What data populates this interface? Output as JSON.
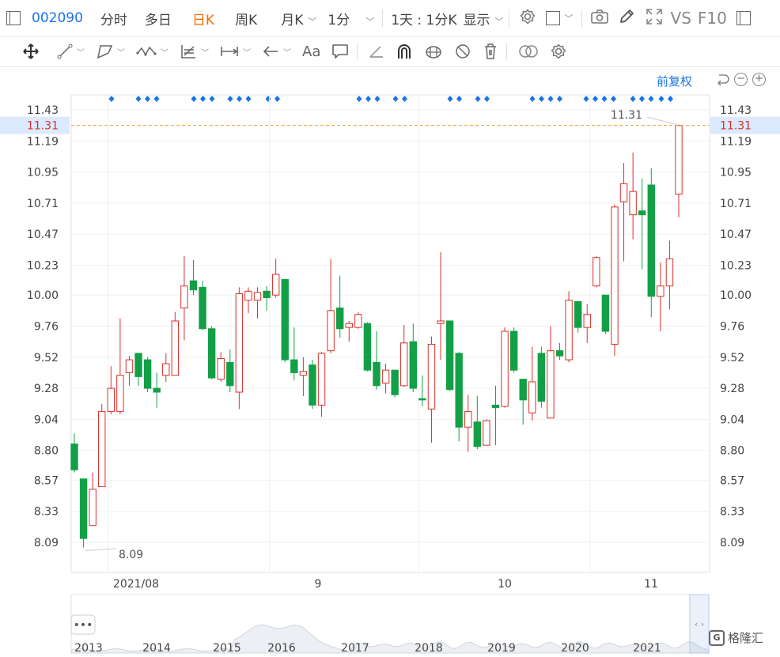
{
  "header": {
    "code": "002090",
    "tabs": [
      "分时",
      "多日",
      "日K",
      "周K",
      "月K",
      "1分"
    ],
    "active_tab": "日K",
    "range_label": "1天 : 1分K",
    "display_label": "显示",
    "vs_label": "VS",
    "f10_label": "F10"
  },
  "toolbar": {
    "tools": [
      "move-icon",
      "line-icon",
      "channel-icon",
      "wave-icon",
      "fib-icon",
      "measure-icon",
      "arrow-icon",
      "text-icon",
      "note-icon",
      "pen-icon",
      "magnet-icon",
      "lock-icon",
      "hide-icon",
      "delete-icon",
      "compare-icon",
      "settings-icon"
    ],
    "text_tool_label": "Aa"
  },
  "chart_controls": {
    "adjust_label": "前复权"
  },
  "chart_data": {
    "type": "candlestick",
    "y_ticks": [
      "11.43",
      "11.19",
      "10.95",
      "10.71",
      "10.47",
      "10.23",
      "10.00",
      "9.76",
      "9.52",
      "9.28",
      "9.04",
      "8.80",
      "8.57",
      "8.33",
      "8.09"
    ],
    "ylim": [
      8.0,
      11.51
    ],
    "x_labels": [
      "2021/08",
      "9",
      "10",
      "11"
    ],
    "current_price": "11.31",
    "max_label": "11.31",
    "min_label": "8.09",
    "colors": {
      "up": "#d9312b",
      "down": "#12a047",
      "marker": "#1a73e8",
      "price_line": "#e6a23c"
    },
    "candles": [
      {
        "o": 8.85,
        "h": 8.93,
        "l": 8.63,
        "c": 8.65
      },
      {
        "o": 8.58,
        "h": 8.58,
        "l": 8.05,
        "c": 8.12
      },
      {
        "o": 8.22,
        "h": 8.63,
        "l": 8.22,
        "c": 8.5
      },
      {
        "o": 8.52,
        "h": 9.16,
        "l": 8.52,
        "c": 9.1
      },
      {
        "o": 9.1,
        "h": 9.45,
        "l": 9.08,
        "c": 9.28
      },
      {
        "o": 9.1,
        "h": 9.82,
        "l": 9.08,
        "c": 9.38
      },
      {
        "o": 9.4,
        "h": 9.53,
        "l": 9.3,
        "c": 9.5
      },
      {
        "o": 9.55,
        "h": 9.55,
        "l": 9.3,
        "c": 9.37
      },
      {
        "o": 9.5,
        "h": 9.52,
        "l": 9.25,
        "c": 9.28
      },
      {
        "o": 9.28,
        "h": 9.4,
        "l": 9.13,
        "c": 9.25
      },
      {
        "o": 9.38,
        "h": 9.55,
        "l": 9.33,
        "c": 9.47
      },
      {
        "o": 9.38,
        "h": 9.87,
        "l": 9.38,
        "c": 9.8
      },
      {
        "o": 9.9,
        "h": 10.3,
        "l": 9.65,
        "c": 10.07
      },
      {
        "o": 10.11,
        "h": 10.27,
        "l": 10.0,
        "c": 10.04
      },
      {
        "o": 10.06,
        "h": 10.11,
        "l": 9.73,
        "c": 9.74
      },
      {
        "o": 9.74,
        "h": 9.76,
        "l": 9.35,
        "c": 9.36
      },
      {
        "o": 9.35,
        "h": 9.56,
        "l": 9.33,
        "c": 9.51
      },
      {
        "o": 9.48,
        "h": 9.58,
        "l": 9.25,
        "c": 9.3
      },
      {
        "o": 9.25,
        "h": 10.06,
        "l": 9.12,
        "c": 10.01
      },
      {
        "o": 9.96,
        "h": 10.06,
        "l": 9.86,
        "c": 10.03
      },
      {
        "o": 9.96,
        "h": 10.06,
        "l": 9.82,
        "c": 10.02
      },
      {
        "o": 10.03,
        "h": 10.07,
        "l": 9.88,
        "c": 9.98
      },
      {
        "o": 10.0,
        "h": 10.28,
        "l": 9.98,
        "c": 10.16
      },
      {
        "o": 10.12,
        "h": 10.12,
        "l": 9.48,
        "c": 9.5
      },
      {
        "o": 9.5,
        "h": 9.75,
        "l": 9.34,
        "c": 9.4
      },
      {
        "o": 9.38,
        "h": 9.52,
        "l": 9.22,
        "c": 9.41
      },
      {
        "o": 9.46,
        "h": 9.5,
        "l": 9.12,
        "c": 9.15
      },
      {
        "o": 9.15,
        "h": 9.56,
        "l": 9.06,
        "c": 9.55
      },
      {
        "o": 9.57,
        "h": 10.28,
        "l": 9.55,
        "c": 9.88
      },
      {
        "o": 9.9,
        "h": 10.15,
        "l": 9.67,
        "c": 9.74
      },
      {
        "o": 9.75,
        "h": 9.8,
        "l": 9.64,
        "c": 9.78
      },
      {
        "o": 9.75,
        "h": 9.87,
        "l": 9.74,
        "c": 9.85
      },
      {
        "o": 9.78,
        "h": 9.79,
        "l": 9.41,
        "c": 9.42
      },
      {
        "o": 9.48,
        "h": 9.72,
        "l": 9.27,
        "c": 9.3
      },
      {
        "o": 9.32,
        "h": 9.47,
        "l": 9.24,
        "c": 9.42
      },
      {
        "o": 9.42,
        "h": 9.42,
        "l": 9.21,
        "c": 9.23
      },
      {
        "o": 9.3,
        "h": 9.77,
        "l": 9.29,
        "c": 9.63
      },
      {
        "o": 9.64,
        "h": 9.78,
        "l": 9.25,
        "c": 9.28
      },
      {
        "o": 9.2,
        "h": 9.38,
        "l": 9.14,
        "c": 9.19
      },
      {
        "o": 9.12,
        "h": 9.68,
        "l": 8.86,
        "c": 9.62
      },
      {
        "o": 9.78,
        "h": 10.33,
        "l": 9.5,
        "c": 9.8
      },
      {
        "o": 9.8,
        "h": 9.8,
        "l": 9.26,
        "c": 9.27
      },
      {
        "o": 9.55,
        "h": 9.56,
        "l": 8.87,
        "c": 8.98
      },
      {
        "o": 8.98,
        "h": 9.23,
        "l": 8.79,
        "c": 9.1
      },
      {
        "o": 9.02,
        "h": 9.22,
        "l": 8.81,
        "c": 8.83
      },
      {
        "o": 8.84,
        "h": 9.04,
        "l": 8.84,
        "c": 9.03
      },
      {
        "o": 9.15,
        "h": 9.3,
        "l": 8.84,
        "c": 9.13
      },
      {
        "o": 9.14,
        "h": 9.75,
        "l": 9.13,
        "c": 9.72
      },
      {
        "o": 9.72,
        "h": 9.75,
        "l": 9.4,
        "c": 9.42
      },
      {
        "o": 9.35,
        "h": 9.35,
        "l": 9.0,
        "c": 9.19
      },
      {
        "o": 9.09,
        "h": 9.6,
        "l": 9.03,
        "c": 9.33
      },
      {
        "o": 9.55,
        "h": 9.6,
        "l": 9.13,
        "c": 9.18
      },
      {
        "o": 9.05,
        "h": 9.76,
        "l": 9.05,
        "c": 9.57
      },
      {
        "o": 9.57,
        "h": 9.63,
        "l": 9.5,
        "c": 9.53
      },
      {
        "o": 9.5,
        "h": 10.03,
        "l": 9.48,
        "c": 9.96
      },
      {
        "o": 9.95,
        "h": 9.95,
        "l": 9.71,
        "c": 9.75
      },
      {
        "o": 9.75,
        "h": 9.93,
        "l": 9.63,
        "c": 9.85
      },
      {
        "o": 10.07,
        "h": 10.3,
        "l": 10.06,
        "c": 10.29
      },
      {
        "o": 10.0,
        "h": 10.0,
        "l": 9.7,
        "c": 9.72
      },
      {
        "o": 9.62,
        "h": 10.7,
        "l": 9.53,
        "c": 10.68
      },
      {
        "o": 10.72,
        "h": 11.02,
        "l": 10.26,
        "c": 10.86
      },
      {
        "o": 10.62,
        "h": 11.1,
        "l": 10.43,
        "c": 10.8
      },
      {
        "o": 10.65,
        "h": 10.9,
        "l": 10.2,
        "c": 10.62
      },
      {
        "o": 10.85,
        "h": 10.98,
        "l": 9.83,
        "c": 9.99
      },
      {
        "o": 9.99,
        "h": 10.25,
        "l": 9.72,
        "c": 10.07
      },
      {
        "o": 10.07,
        "h": 10.42,
        "l": 9.89,
        "c": 10.28
      },
      {
        "o": 10.78,
        "h": 11.31,
        "l": 10.6,
        "c": 11.31
      }
    ],
    "marker_groups": [
      1,
      3,
      3,
      3,
      2,
      3,
      2,
      2,
      2,
      4,
      4,
      3,
      2,
      3
    ],
    "navigator_years": [
      "2013",
      "2014",
      "2015",
      "2016",
      "2017",
      "2018",
      "2019",
      "2020",
      "2021"
    ]
  },
  "brand": {
    "label": "格隆汇"
  }
}
